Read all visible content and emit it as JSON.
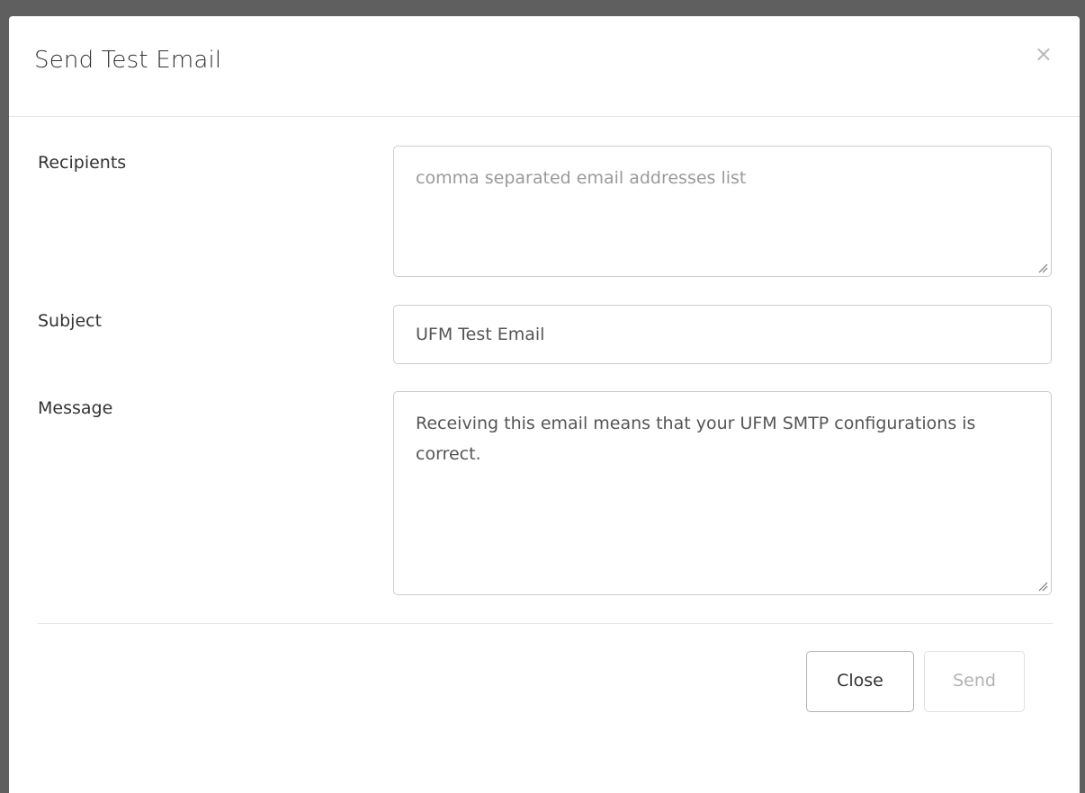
{
  "dialog": {
    "title": "Send Test Email",
    "close_glyph": "×"
  },
  "form": {
    "recipients": {
      "label": "Recipients",
      "value": "",
      "placeholder": "comma separated email addresses list"
    },
    "subject": {
      "label": "Subject",
      "value": "UFM Test Email"
    },
    "message": {
      "label": "Message",
      "value": "Receiving this email means that your UFM SMTP configurations is correct."
    }
  },
  "footer": {
    "close_label": "Close",
    "send_label": "Send",
    "send_disabled": true
  },
  "icons": {
    "close": "close-icon",
    "resize": "resize-grip-icon"
  }
}
